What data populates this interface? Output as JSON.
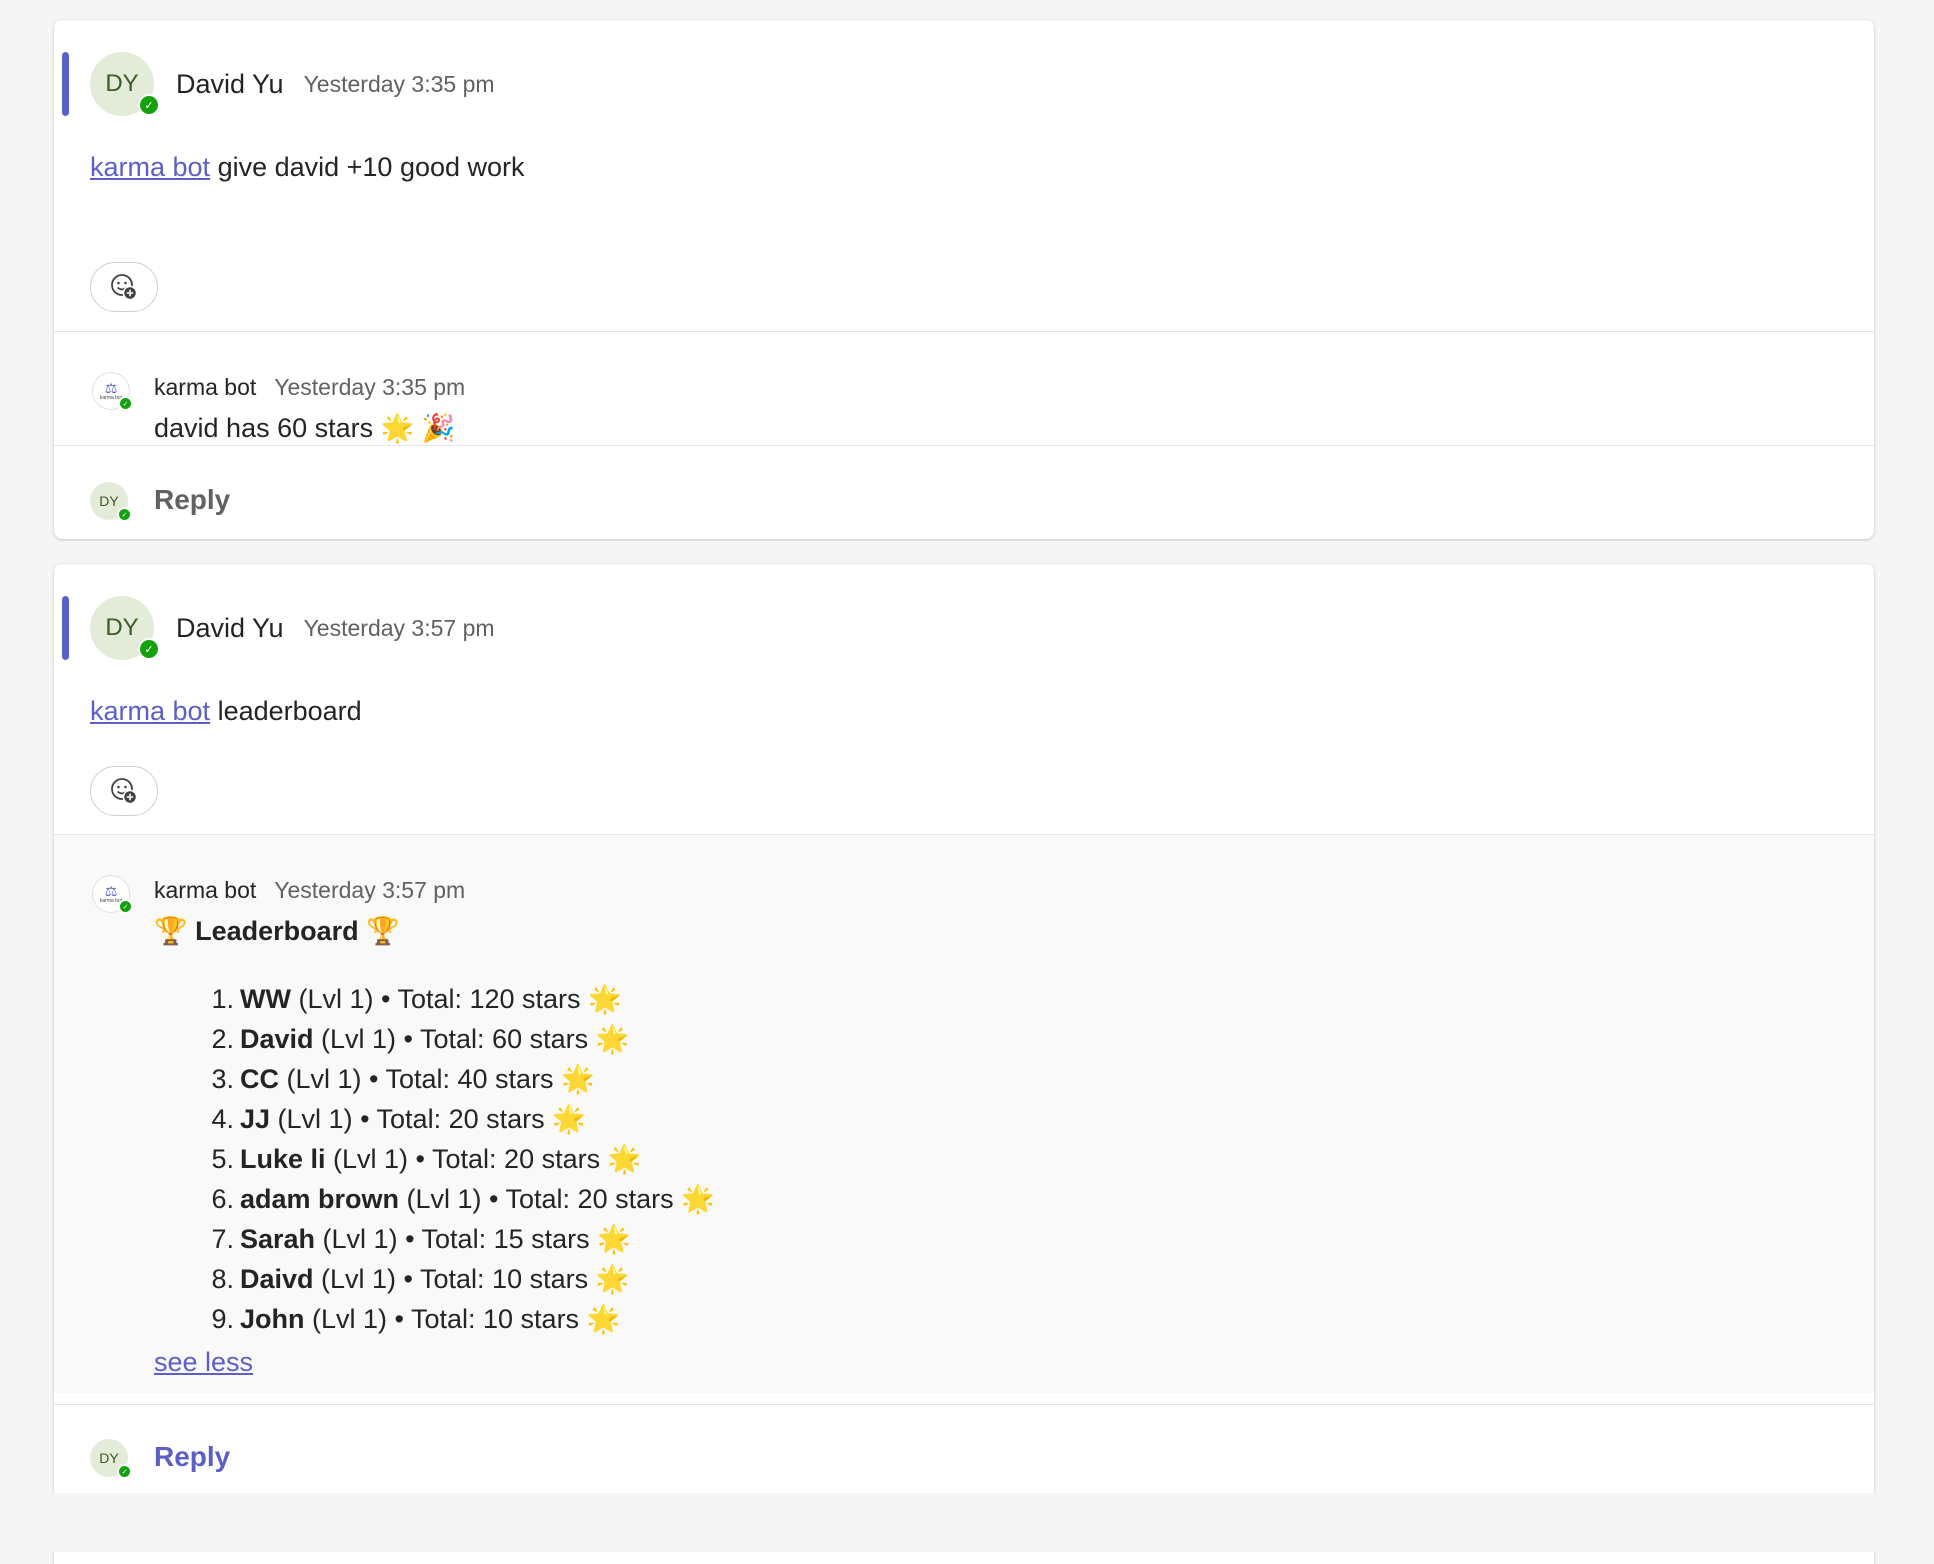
{
  "post1": {
    "avatar_initials": "DY",
    "author": "David Yu",
    "time": "Yesterday 3:35 pm",
    "mention": "karma bot",
    "message": " give david +10 good work",
    "reply": {
      "author": "karma bot",
      "avatar_label": "karma bot",
      "time": "Yesterday 3:35 pm",
      "text": "david has 60 stars 🌟 🎉"
    },
    "reply_avatar_initials": "DY",
    "reply_label": "Reply"
  },
  "post2": {
    "avatar_initials": "DY",
    "author": "David Yu",
    "time": "Yesterday 3:57 pm",
    "mention": "karma bot",
    "message": " leaderboard",
    "reply": {
      "author": "karma bot",
      "avatar_label": "karma bot",
      "time": "Yesterday 3:57 pm",
      "title": "🏆 Leaderboard 🏆",
      "entries": [
        {
          "rank": "1.",
          "name": "WW",
          "detail": " (Lvl 1) • Total: 120 stars 🌟"
        },
        {
          "rank": "2.",
          "name": "David",
          "detail": " (Lvl 1) • Total: 60 stars 🌟"
        },
        {
          "rank": "3.",
          "name": "CC",
          "detail": " (Lvl 1) • Total: 40 stars 🌟"
        },
        {
          "rank": "4.",
          "name": "JJ",
          "detail": " (Lvl 1) • Total: 20 stars 🌟"
        },
        {
          "rank": "5.",
          "name": "Luke li",
          "detail": " (Lvl 1) • Total: 20 stars 🌟"
        },
        {
          "rank": "6.",
          "name": "adam brown",
          "detail": " (Lvl 1) • Total: 20 stars 🌟"
        },
        {
          "rank": "7.",
          "name": "Sarah",
          "detail": " (Lvl 1) • Total: 15 stars 🌟"
        },
        {
          "rank": "8.",
          "name": "Daivd",
          "detail": " (Lvl 1) • Total: 10 stars 🌟"
        },
        {
          "rank": "9.",
          "name": "John",
          "detail": " (Lvl 1) • Total: 10 stars 🌟"
        }
      ],
      "see_less": "see less"
    },
    "reply_avatar_initials": "DY",
    "reply_label": "Reply"
  },
  "colors": {
    "accent": "#5b5fc7",
    "presence": "#13a10e",
    "avatar_bg": "#e3ebd9",
    "reply_label_post1": "#616161",
    "reply_label_post2": "#5b5fc7"
  }
}
